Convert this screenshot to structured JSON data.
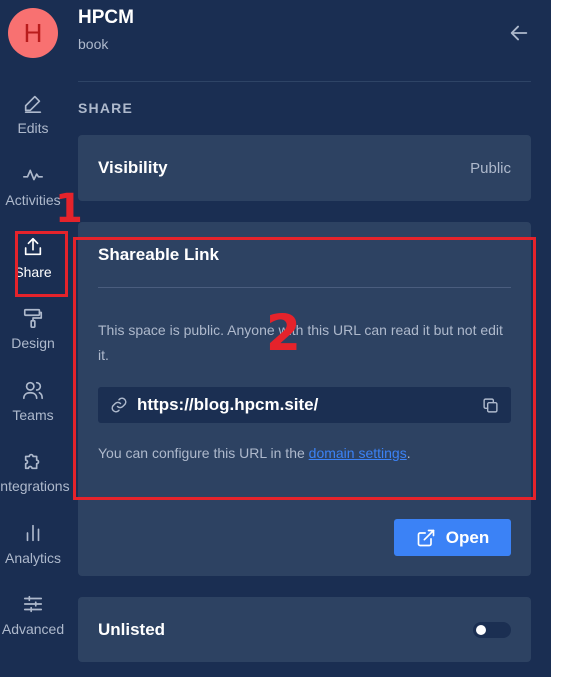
{
  "space": {
    "avatar_letter": "H",
    "name": "HPCM",
    "type": "book"
  },
  "sidebar": {
    "items": [
      {
        "label": "Edits",
        "icon": "pencil-icon"
      },
      {
        "label": "Activities",
        "icon": "activity-icon"
      },
      {
        "label": "Share",
        "icon": "share-icon",
        "active": true
      },
      {
        "label": "Design",
        "icon": "paint-roller-icon"
      },
      {
        "label": "Teams",
        "icon": "users-icon"
      },
      {
        "label": "Integrations",
        "icon": "puzzle-icon"
      },
      {
        "label": "Analytics",
        "icon": "bar-chart-icon"
      },
      {
        "label": "Advanced",
        "icon": "sliders-icon"
      }
    ]
  },
  "section_title": "SHARE",
  "visibility": {
    "label": "Visibility",
    "value": "Public"
  },
  "shareable_link": {
    "title": "Shareable Link",
    "description": "This space is public. Anyone with this URL can read it but not edit it.",
    "url": "https://blog.hpcm.site/",
    "config_prefix": "You can configure this URL in the ",
    "config_link": "domain settings",
    "config_suffix": ".",
    "open_label": "Open"
  },
  "unlisted": {
    "label": "Unlisted",
    "enabled": false
  },
  "annotations": {
    "label_1": "1",
    "label_2": "2",
    "color": "#e5232b"
  },
  "colors": {
    "background": "#1a2e52",
    "card": "#2d4262",
    "accent": "#3b82f6"
  }
}
